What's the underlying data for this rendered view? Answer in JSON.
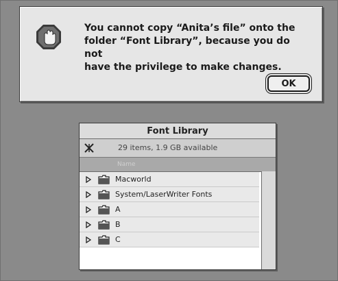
{
  "alert": {
    "message": "You cannot copy “Anita’s file” onto the\nfolder “Font Library”, because you do not\nhave the privilege to make changes.",
    "ok_label": "OK",
    "icon": "stop-hand-icon"
  },
  "finder": {
    "title": "Font Library",
    "info": "29 items, 1.9 GB available",
    "column_header": "Name",
    "items": [
      {
        "label": "Macworld"
      },
      {
        "label": "System/LaserWriter Fonts"
      },
      {
        "label": "A"
      },
      {
        "label": "B"
      },
      {
        "label": "C"
      }
    ]
  }
}
